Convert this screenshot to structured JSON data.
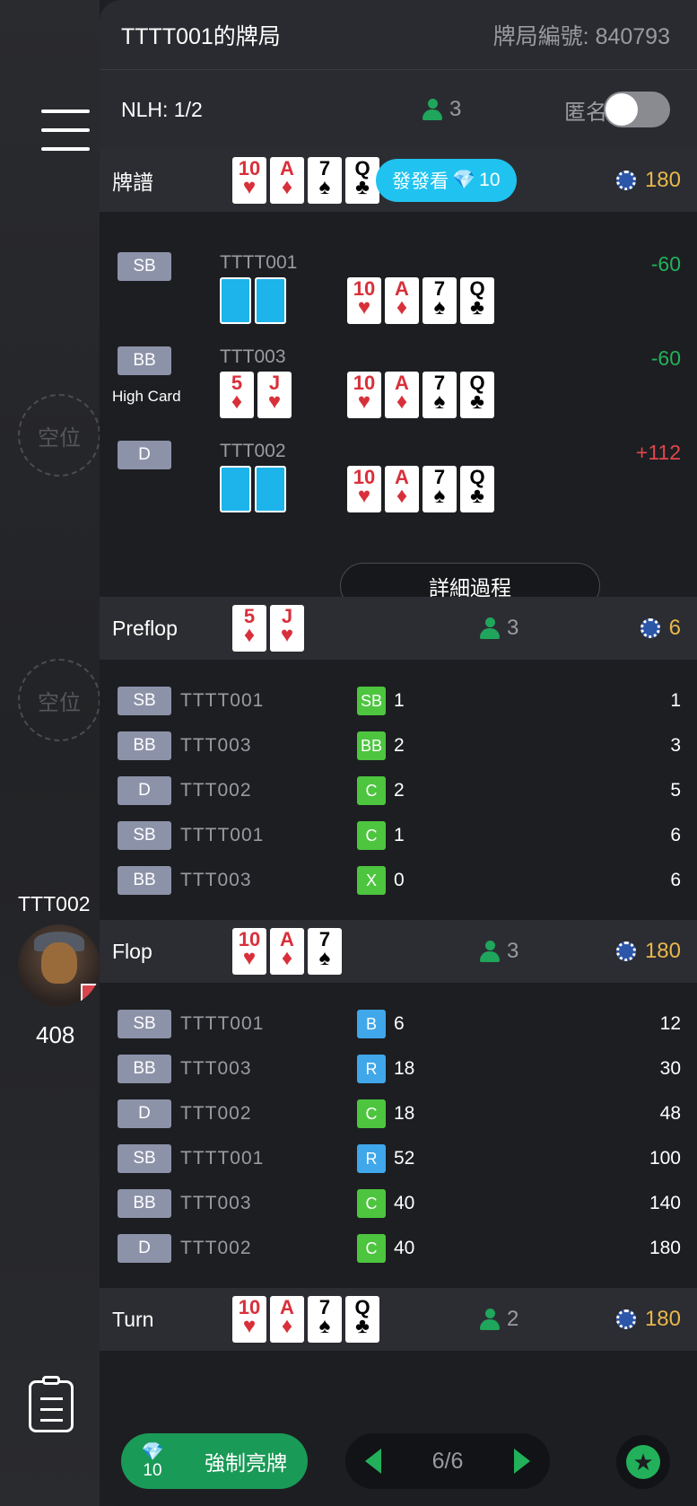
{
  "header": {
    "title": "TTTT001的牌局",
    "game_id_label": "牌局編號: 840793"
  },
  "subheader": {
    "blinds": "NLH: 1/2",
    "players": "3",
    "anonymous_label": "匿名",
    "anonymous_on": false
  },
  "side": {
    "seat1": "空位",
    "seat2": "空位",
    "player_name": "TTT002",
    "player_chips": "408"
  },
  "summary": {
    "label": "牌譜",
    "board": [
      {
        "r": "10",
        "s": "♥",
        "c": "red"
      },
      {
        "r": "A",
        "s": "♦",
        "c": "red"
      },
      {
        "r": "7",
        "s": "♠",
        "c": "black"
      },
      {
        "r": "Q",
        "s": "♣",
        "c": "black"
      }
    ],
    "deal_button": "發發看",
    "deal_cost": "10",
    "pot": "180",
    "rows": [
      {
        "pos": "SB",
        "name": "TTTT001",
        "net": "-60",
        "hand": "",
        "hole": []
      },
      {
        "pos": "BB",
        "name": "TTT003",
        "net": "-60",
        "hand": "High Card",
        "hole": [
          {
            "r": "5",
            "s": "♦",
            "c": "red"
          },
          {
            "r": "J",
            "s": "♥",
            "c": "red"
          }
        ]
      },
      {
        "pos": "D",
        "name": "TTT002",
        "net": "+112",
        "hand": "",
        "hole": []
      }
    ],
    "detail_button": "詳細過程"
  },
  "streets": [
    {
      "label": "Preflop",
      "cards": [
        {
          "r": "5",
          "s": "♦",
          "c": "red"
        },
        {
          "r": "J",
          "s": "♥",
          "c": "red"
        }
      ],
      "players": "3",
      "pot": "6",
      "actions": [
        {
          "pos": "SB",
          "name": "TTTT001",
          "act": "SB",
          "color": "g",
          "amt": "1",
          "total": "1"
        },
        {
          "pos": "BB",
          "name": "TTT003",
          "act": "BB",
          "color": "g",
          "amt": "2",
          "total": "3"
        },
        {
          "pos": "D",
          "name": "TTT002",
          "act": "C",
          "color": "g",
          "amt": "2",
          "total": "5"
        },
        {
          "pos": "SB",
          "name": "TTTT001",
          "act": "C",
          "color": "g",
          "amt": "1",
          "total": "6"
        },
        {
          "pos": "BB",
          "name": "TTT003",
          "act": "X",
          "color": "g",
          "amt": "0",
          "total": "6"
        }
      ]
    },
    {
      "label": "Flop",
      "cards": [
        {
          "r": "10",
          "s": "♥",
          "c": "red"
        },
        {
          "r": "A",
          "s": "♦",
          "c": "red"
        },
        {
          "r": "7",
          "s": "♠",
          "c": "black"
        }
      ],
      "players": "3",
      "pot": "180",
      "actions": [
        {
          "pos": "SB",
          "name": "TTTT001",
          "act": "B",
          "color": "b",
          "amt": "6",
          "total": "12"
        },
        {
          "pos": "BB",
          "name": "TTT003",
          "act": "R",
          "color": "b",
          "amt": "18",
          "total": "30"
        },
        {
          "pos": "D",
          "name": "TTT002",
          "act": "C",
          "color": "g",
          "amt": "18",
          "total": "48"
        },
        {
          "pos": "SB",
          "name": "TTTT001",
          "act": "R",
          "color": "b",
          "amt": "52",
          "total": "100"
        },
        {
          "pos": "BB",
          "name": "TTT003",
          "act": "C",
          "color": "g",
          "amt": "40",
          "total": "140"
        },
        {
          "pos": "D",
          "name": "TTT002",
          "act": "C",
          "color": "g",
          "amt": "40",
          "total": "180"
        }
      ]
    },
    {
      "label": "Turn",
      "cards": [
        {
          "r": "10",
          "s": "♥",
          "c": "red"
        },
        {
          "r": "A",
          "s": "♦",
          "c": "red"
        },
        {
          "r": "7",
          "s": "♠",
          "c": "black"
        },
        {
          "r": "Q",
          "s": "♣",
          "c": "black"
        }
      ],
      "players": "2",
      "pot": "180",
      "actions": []
    }
  ],
  "footer": {
    "force_show_cost": "10",
    "force_show_label": "強制亮牌",
    "page": "6/6"
  }
}
